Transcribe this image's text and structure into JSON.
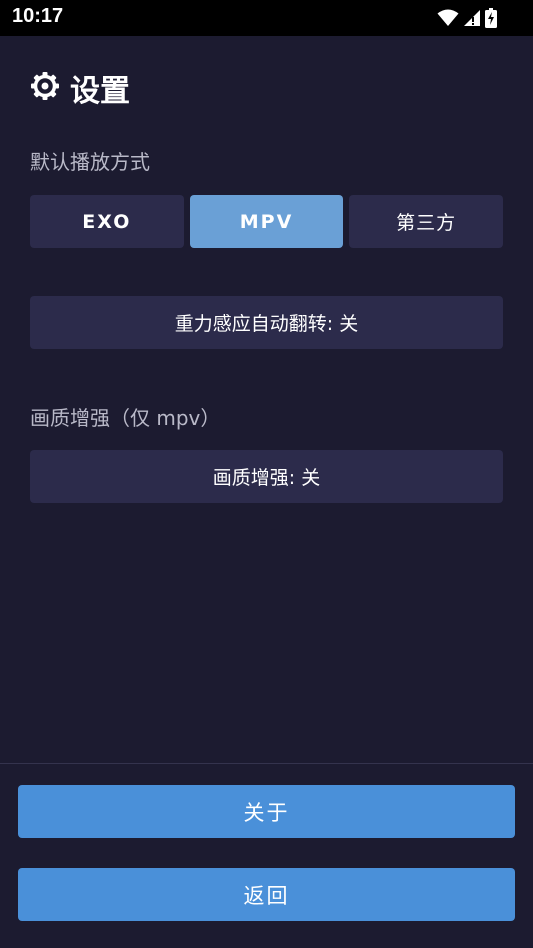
{
  "status_bar": {
    "time": "10:17",
    "icons": [
      "wifi-icon",
      "signal-icon",
      "battery-charging-icon"
    ]
  },
  "header": {
    "icon": "gear-icon",
    "title": "设置"
  },
  "playback": {
    "label": "默认播放方式",
    "options": [
      "EXO",
      "MPV",
      "第三方"
    ],
    "selected": "MPV"
  },
  "gravity": {
    "button_label": "重力感应自动翻转: 关"
  },
  "quality": {
    "label": "画质增强（仅 mpv）",
    "button_label": "画质增强: 关"
  },
  "footer": {
    "about_label": "关于",
    "back_label": "返回"
  },
  "colors": {
    "background": "#1c1b30",
    "card": "#2c2b4b",
    "selected": "#6aa0d6",
    "primary": "#4a90d9"
  }
}
